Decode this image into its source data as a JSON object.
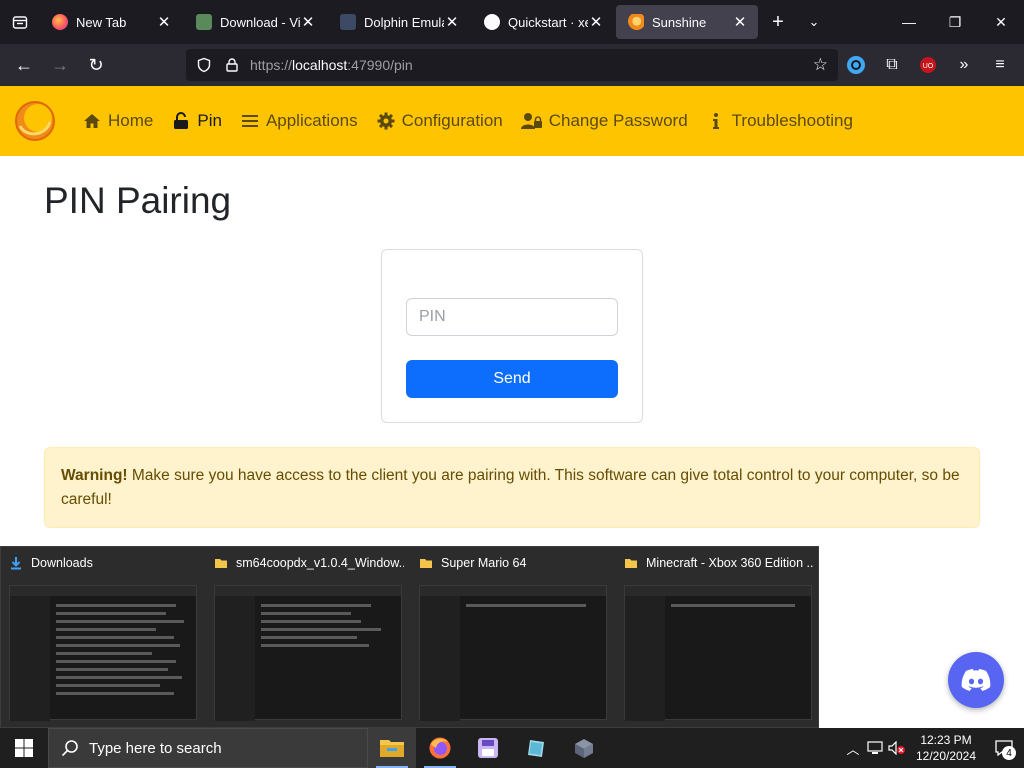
{
  "browser": {
    "tabs": [
      {
        "title": "New Tab",
        "active": false
      },
      {
        "title": "Download - Vige",
        "active": false
      },
      {
        "title": "Dolphin Emulato",
        "active": false
      },
      {
        "title": "Quickstart · xeni",
        "active": false
      },
      {
        "title": "Sunshine",
        "active": true
      }
    ],
    "url_prefix": "https://",
    "url_host": "localhost",
    "url_rest": ":47990/pin"
  },
  "app_nav": {
    "items": [
      {
        "label": "Home",
        "icon": "house-icon"
      },
      {
        "label": "Pin",
        "icon": "unlock-icon"
      },
      {
        "label": "Applications",
        "icon": "list-icon"
      },
      {
        "label": "Configuration",
        "icon": "gear-icon"
      },
      {
        "label": "Change Password",
        "icon": "user-lock-icon"
      },
      {
        "label": "Troubleshooting",
        "icon": "info-icon"
      }
    ],
    "active": "Pin",
    "accent": "#ffc400"
  },
  "page": {
    "title": "PIN Pairing",
    "pin_placeholder": "PIN",
    "pin_value": "",
    "send_label": "Send",
    "warning_strong": "Warning!",
    "warning_text": " Make sure you have access to the client you are pairing with. This software can give total control to your computer, so be careful!"
  },
  "preview": {
    "windows": [
      {
        "title": "Downloads",
        "icon": "download-folder-icon"
      },
      {
        "title": "sm64coopdx_v1.0.4_Window...",
        "icon": "folder-icon"
      },
      {
        "title": "Super Mario 64",
        "icon": "folder-icon"
      },
      {
        "title": "Minecraft - Xbox 360 Edition ...",
        "icon": "folder-icon"
      }
    ]
  },
  "taskbar": {
    "search_placeholder": "Type here to search",
    "time": "12:23 PM",
    "date": "12/20/2024",
    "notification_count": "4"
  },
  "colors": {
    "primary_button": "#0d6efd",
    "warning_bg": "#fff3cd",
    "discord": "#5865f2"
  }
}
